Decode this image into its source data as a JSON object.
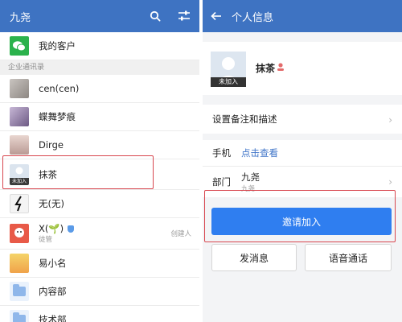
{
  "left": {
    "app_title": "九尧",
    "my_clients": "我的客户",
    "section_label": "企业通讯录",
    "contacts": [
      {
        "name": "cen(cen)"
      },
      {
        "name": "蝶舞梦痕"
      },
      {
        "name": "Dirge"
      },
      {
        "name": "抹茶",
        "badge": "未加入"
      },
      {
        "name": "无(无)"
      },
      {
        "name": "X(🌱)",
        "sub": "徒管",
        "meta": "创建人"
      },
      {
        "name": "易小名"
      },
      {
        "name": "内容部"
      },
      {
        "name": "技术部"
      }
    ]
  },
  "right": {
    "title": "个人信息",
    "profile_name": "抹茶",
    "avatar_badge": "未加入",
    "set_remark": "设置备注和描述",
    "phone_label": "手机",
    "phone_action": "点击查看",
    "dept_label": "部门",
    "dept_value": "九尧",
    "dept_sub": "九尧",
    "invite_button": "邀请加入",
    "message_button": "发消息",
    "voice_button": "语音通话"
  },
  "colors": {
    "header": "#3e73c2",
    "primary_button": "#2f7ef0",
    "link": "#3f74c8",
    "highlight": "#d8474f"
  }
}
